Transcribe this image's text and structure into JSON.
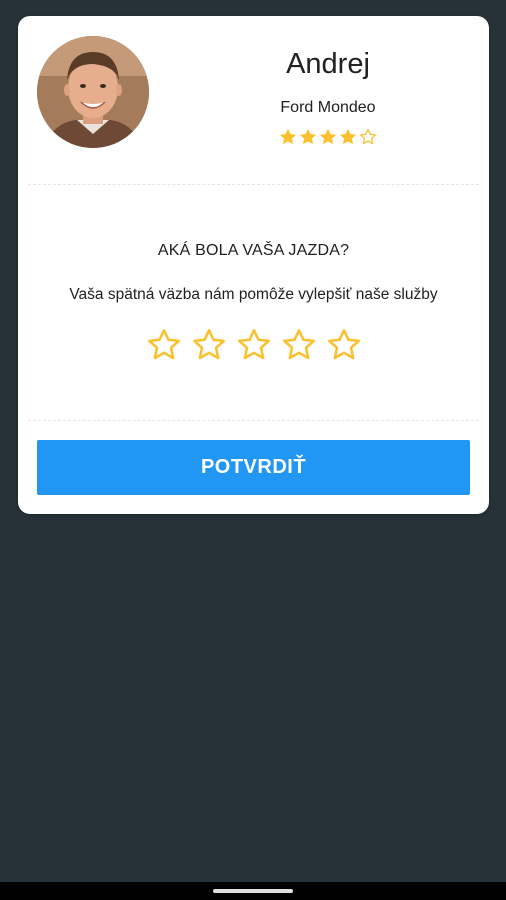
{
  "driver": {
    "name": "Andrej",
    "car": "Ford Mondeo",
    "rating": 4,
    "rating_max": 5
  },
  "feedback": {
    "question": "AKÁ BOLA VAŠA JAZDA?",
    "hint": "Vaša spätná väzba nám pomôže vylepšiť naše služby",
    "selected_rating": 0,
    "star_count": 5
  },
  "actions": {
    "confirm_label": "POTVRDIŤ"
  },
  "colors": {
    "background": "#263238",
    "card": "#ffffff",
    "accent": "#2196f3",
    "star": "#fbc02d",
    "text": "#212121"
  },
  "icons": {
    "filled_star": "star-filled-icon",
    "empty_star": "star-outline-icon"
  }
}
